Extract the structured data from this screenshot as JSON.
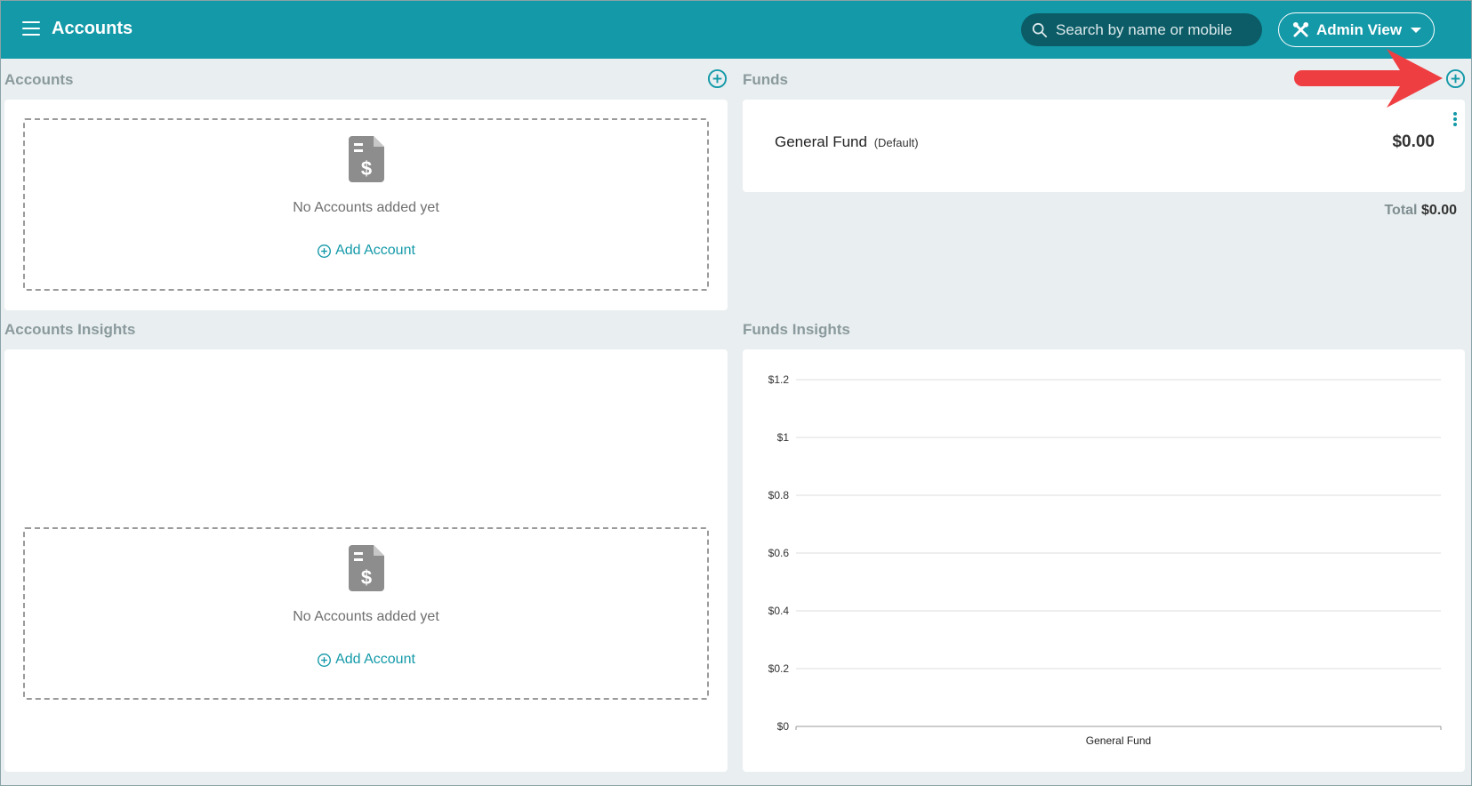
{
  "header": {
    "title": "Accounts",
    "search_placeholder": "Search by name or mobile",
    "admin_label": "Admin View"
  },
  "accounts": {
    "title": "Accounts",
    "empty_text": "No Accounts added yet",
    "add_label": "Add Account"
  },
  "funds": {
    "title": "Funds",
    "items": [
      {
        "name": "General Fund",
        "tag": "(Default)",
        "amount": "$0.00"
      }
    ],
    "total_label": "Total",
    "total_value": "$0.00"
  },
  "accounts_insights": {
    "title": "Accounts Insights",
    "empty_text": "No Accounts added yet",
    "add_label": "Add Account"
  },
  "funds_insights": {
    "title": "Funds Insights"
  },
  "chart_data": {
    "type": "bar",
    "categories": [
      "General Fund"
    ],
    "values": [
      0
    ],
    "y_ticks": [
      "$1.2",
      "$1",
      "$0.8",
      "$0.6",
      "$0.4",
      "$0.2",
      "$0"
    ],
    "ylim": [
      0,
      1.2
    ],
    "grid": true
  },
  "colors": {
    "accent": "#1399a8",
    "header_bg": "#1399a8",
    "search_bg": "#0b5c66",
    "annotation_arrow": "#ef3e42"
  }
}
